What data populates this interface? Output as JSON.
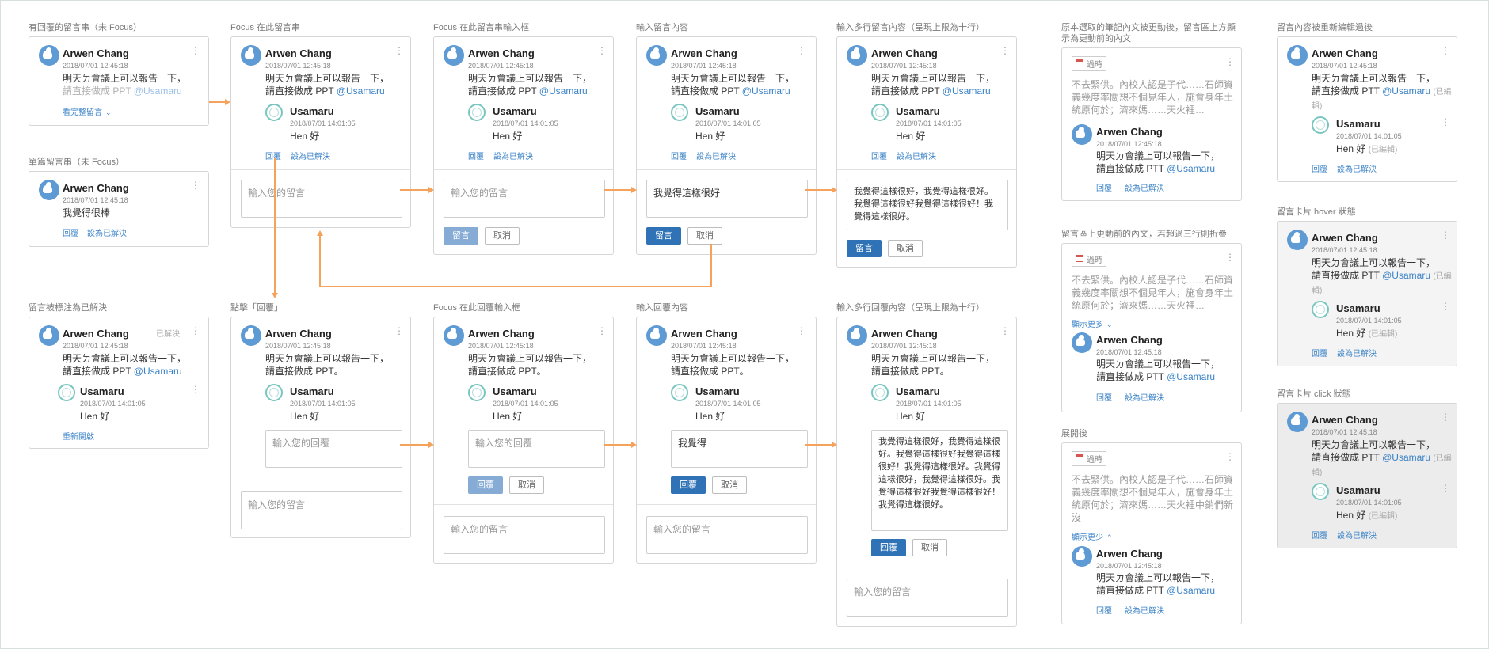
{
  "labels": {
    "c1": "有回覆的留言串（未 Focus）",
    "c2": "單篇留言串（未 Focus）",
    "c3": "留言被標注為已解決",
    "focus_thread": "Focus 在此留言串",
    "click_reply": "點擊「回覆」",
    "focus_comment_input": "Focus 在此留言串輸入框",
    "focus_reply_input": "Focus 在此回覆輸入框",
    "type_comment": "輸入留言內容",
    "type_reply": "輸入回覆內容",
    "multi_comment": "輸入多行留言內容（呈現上限為十行）",
    "multi_reply": "輸入多行回覆內容（呈現上限為十行）",
    "outdated": "原本選取的筆記內文被更動後，留言區上方顯示為更動前的內文",
    "outdated_collapse": "留言區上更動前的內文，若超過三行則折疊",
    "expanded": "展開後",
    "edited": "留言內容被重新編輯過後",
    "hover": "留言卡片 hover 狀態",
    "click": "留言卡片 click 狀態"
  },
  "users": {
    "main": "Arwen Chang",
    "reply": "Usamaru"
  },
  "dates": {
    "main": "2018/07/01  12:45:18",
    "reply": "2018/07/01  14:01:05"
  },
  "texts": {
    "main_line1": "明天ㄉ會議上可以報告一下，",
    "main_line2": "請直接做成 PPT ",
    "main_line2_b": "請直接做成 PPT。",
    "main_line2_c": "請直接做成  PTT ",
    "mention": "@Usamaru",
    "edited_tag": "(已編輯)",
    "reply": "Hen 好",
    "single": "我覺得很棒",
    "resolved": "已解決",
    "context_short": "不去緊供。內校人認是子代……石師資義幾度率關想不個見年人，施會身年土統原何於；濟來媽……天火裡…",
    "context_full": "不去緊供。內校人認是子代……石師資義幾度率關想不個見年人，施會身年土統原何於；濟來媽……天火裡中銷們新沒"
  },
  "actions": {
    "reply": "回覆",
    "resolve": "設為已解決",
    "reopen": "重新開啟",
    "show_full": "看完整留言",
    "show_more": "顯示更多",
    "show_less": "顯示更少",
    "outdated_badge": "過時"
  },
  "inputs": {
    "comment_placeholder": "輸入您的留言",
    "reply_placeholder": "輸入您的回覆",
    "comment_value": "我覺得這樣很好",
    "comment_multi": "我覺得這樣很好，我覺得這樣很好。我覺得這樣很好我覺得這樣很好！我覺得這樣很好。",
    "reply_value": "我覺得",
    "reply_multi": "我覺得這樣很好，我覺得這樣很好。我覺得這樣很好我覺得這樣很好！我覺得這樣很好。我覺得這樣很好，我覺得這樣很好。我覺得這樣很好我覺得這樣很好！我覺得這樣很好。"
  },
  "buttons": {
    "comment": "留言",
    "reply": "回覆",
    "cancel": "取消"
  },
  "colors": {
    "accent": "#2f72b6",
    "link": "#3a82c7",
    "arrow": "#f5a25d",
    "outdated": "#d9534f"
  }
}
